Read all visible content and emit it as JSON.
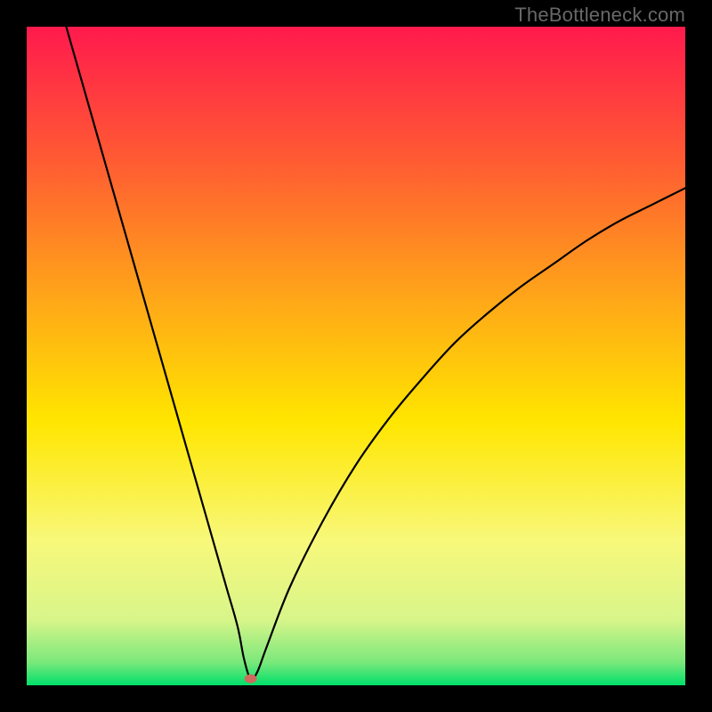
{
  "watermark": "TheBottleneck.com",
  "chart_data": {
    "type": "line",
    "title": "",
    "xlabel": "",
    "ylabel": "",
    "xlim": [
      0,
      100
    ],
    "ylim": [
      0,
      100
    ],
    "curve": {
      "description": "V-shaped bottleneck curve, steep left arm and shallower right arm, minimum near x≈34",
      "left_arm": [
        {
          "x": 6.0,
          "y": 100.0
        },
        {
          "x": 10.0,
          "y": 86.0
        },
        {
          "x": 15.0,
          "y": 68.5
        },
        {
          "x": 20.0,
          "y": 51.0
        },
        {
          "x": 25.0,
          "y": 33.5
        },
        {
          "x": 30.0,
          "y": 16.0
        },
        {
          "x": 32.0,
          "y": 9.0
        },
        {
          "x": 33.0,
          "y": 4.0
        },
        {
          "x": 34.0,
          "y": 1.0
        }
      ],
      "right_arm": [
        {
          "x": 34.0,
          "y": 1.0
        },
        {
          "x": 35.0,
          "y": 2.0
        },
        {
          "x": 36.5,
          "y": 6.0
        },
        {
          "x": 40.0,
          "y": 15.0
        },
        {
          "x": 45.0,
          "y": 25.0
        },
        {
          "x": 50.0,
          "y": 33.5
        },
        {
          "x": 55.0,
          "y": 40.5
        },
        {
          "x": 60.0,
          "y": 46.5
        },
        {
          "x": 65.0,
          "y": 52.0
        },
        {
          "x": 70.0,
          "y": 56.5
        },
        {
          "x": 75.0,
          "y": 60.5
        },
        {
          "x": 80.0,
          "y": 64.0
        },
        {
          "x": 85.0,
          "y": 67.5
        },
        {
          "x": 90.0,
          "y": 70.5
        },
        {
          "x": 95.0,
          "y": 73.0
        },
        {
          "x": 100.0,
          "y": 75.5
        }
      ]
    },
    "marker": {
      "x": 34.0,
      "y": 1.0,
      "color": "#cc6b5e"
    },
    "gradient_stops": [
      {
        "offset": 0.0,
        "color": "#ff1a4d"
      },
      {
        "offset": 0.2,
        "color": "#ff5a33"
      },
      {
        "offset": 0.4,
        "color": "#ffa21a"
      },
      {
        "offset": 0.6,
        "color": "#ffe600"
      },
      {
        "offset": 0.78,
        "color": "#f8f87a"
      },
      {
        "offset": 0.9,
        "color": "#d8f58a"
      },
      {
        "offset": 0.965,
        "color": "#7be87b"
      },
      {
        "offset": 1.0,
        "color": "#00e06a"
      }
    ]
  }
}
